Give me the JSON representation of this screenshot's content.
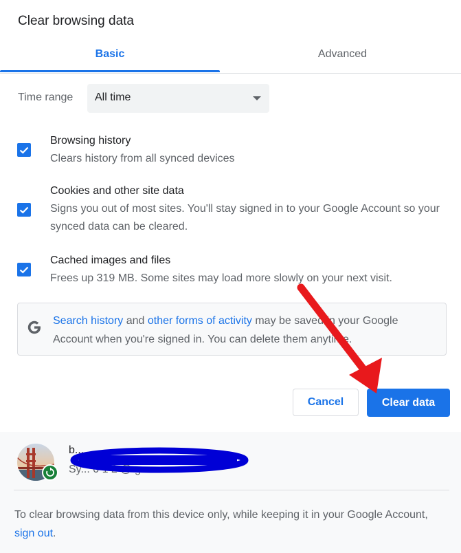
{
  "dialog": {
    "title": "Clear browsing data"
  },
  "tabs": [
    {
      "label": "Basic",
      "selected": true
    },
    {
      "label": "Advanced",
      "selected": false
    }
  ],
  "time_range": {
    "label": "Time range",
    "value": "All time"
  },
  "options": [
    {
      "title": "Browsing history",
      "desc": "Clears history from all synced devices",
      "checked": true
    },
    {
      "title": "Cookies and other site data",
      "desc": "Signs you out of most sites. You'll stay signed in to your Google Account so your synced data can be cleared.",
      "checked": true
    },
    {
      "title": "Cached images and files",
      "desc": "Frees up 319 MB. Some sites may load more slowly on your next visit.",
      "checked": true
    }
  ],
  "info": {
    "link1": "Search history",
    "mid": " and ",
    "link2": "other forms of activity",
    "rest": " may be saved in your Google Account when you're signed in. You can delete them anytime."
  },
  "buttons": {
    "cancel": "Cancel",
    "clear": "Clear data"
  },
  "account": {
    "name": "b...",
    "email": "Sy... 0 1 2 @ g... m"
  },
  "footer": {
    "text": "To clear browsing data from this device only, while keeping it in your Google Account, ",
    "link": "sign out",
    "end": "."
  },
  "colors": {
    "accent": "#1a73e8",
    "annotation_arrow": "#e8191c",
    "redaction": "#0000d6",
    "sync": "#188038"
  }
}
